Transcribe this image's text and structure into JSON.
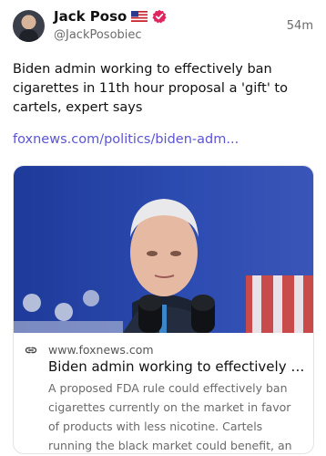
{
  "author": {
    "display_name": "Jack Poso",
    "handle": "@JackPosobiec",
    "timestamp": "54m",
    "badges": [
      "us-flag-icon",
      "verified-icon"
    ]
  },
  "post": {
    "text": "Biden admin working to effectively ban cigarettes in 11th hour proposal a 'gift' to cartels, expert says",
    "link_text": "foxnews.com/politics/biden-adm..."
  },
  "link_card": {
    "icon": "link-icon",
    "domain": "www.foxnews.com",
    "title": "Biden admin working to effectively ba...",
    "description": "A proposed FDA rule could effectively ban cigarettes currently on the market in favor of products with less nicotine. Cartels running the black market could benefit, an expert w..."
  },
  "colors": {
    "link": "#5b55d6",
    "verified_badge": "#e0245e",
    "secondary_text": "#6b6b6b"
  }
}
